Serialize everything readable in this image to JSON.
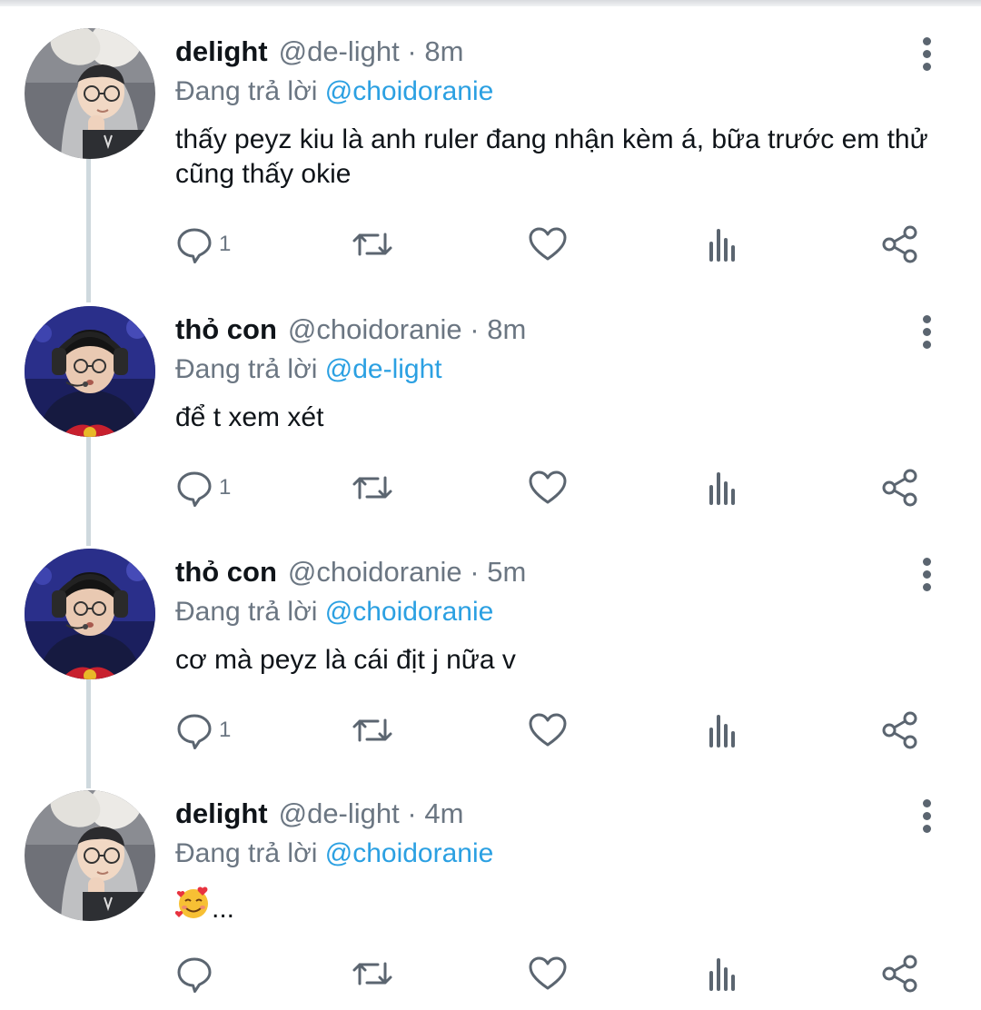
{
  "tweets": [
    {
      "display_name": "delight",
      "handle": "@de-light",
      "time": "8m",
      "replying_prefix": "Đang trả lời",
      "replying_to": "@choidoranie",
      "text": "thấy peyz kiu là anh ruler đang nhận kèm á, bữa trước em thử cũng thấy okie",
      "reply_count": "1",
      "avatar": "avatar-delight"
    },
    {
      "display_name": "thỏ con",
      "handle": "@choidoranie",
      "time": "8m",
      "replying_prefix": "Đang trả lời",
      "replying_to": "@de-light",
      "text": "để t xem xét",
      "reply_count": "1",
      "avatar": "avatar-thocon"
    },
    {
      "display_name": "thỏ con",
      "handle": "@choidoranie",
      "time": "5m",
      "replying_prefix": "Đang trả lời",
      "replying_to": "@choidoranie",
      "text": "cơ mà peyz là cái địt j nữa v",
      "reply_count": "1",
      "avatar": "avatar-thocon"
    },
    {
      "display_name": "delight",
      "handle": "@de-light",
      "time": "4m",
      "replying_prefix": "Đang trả lời",
      "replying_to": "@choidoranie",
      "text": "...",
      "emoji": "smiling-face-with-hearts",
      "reply_count": "",
      "avatar": "avatar-delight"
    }
  ],
  "icons": {
    "reply": "reply-icon",
    "retweet": "retweet-icon",
    "like": "heart-icon",
    "analytics": "analytics-icon",
    "share": "share-icon",
    "menu": "more-vertical-icon"
  },
  "colors": {
    "link": "#2ba0e2",
    "secondary_text": "#6b7682",
    "icon": "#5b6570",
    "thread_line": "#cfd9de"
  }
}
